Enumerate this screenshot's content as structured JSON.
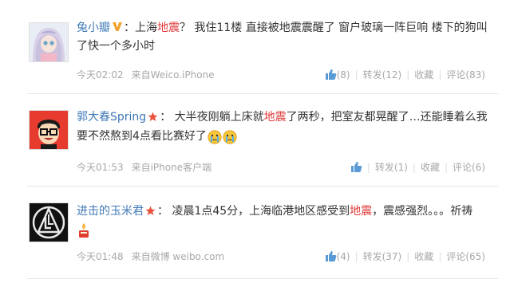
{
  "posts": [
    {
      "user": "兔小瓣",
      "badge": "v-badge",
      "text_before": "：上海",
      "keyword": "地震",
      "text_after": "？ 我住11楼 直接被地震震醒了 窗户玻璃一阵巨响 楼下的狗叫了快一个多小时",
      "time": "今天02:02",
      "source": "来自Weico.iPhone",
      "like_count": "(8)",
      "repost": "转发(12)",
      "favorite": "收藏",
      "comment": "评论(83)"
    },
    {
      "user": "郭大春Spring",
      "badge": "star-badge",
      "text_before": "： 大半夜刚躺上床就",
      "keyword": "地震",
      "text_after": "了两秒，把室友都晃醒了…还能睡着么我要不然熬到4点看比赛好了",
      "time": "今天01:53",
      "source": "来自iPhone客户端",
      "like_count": "",
      "repost": "转发(1)",
      "favorite": "收藏",
      "comment": "评论(6)"
    },
    {
      "user": "进击的玉米君",
      "badge": "star-badge",
      "text_before": "： 凌晨1点45分，上海临港地区感受到",
      "keyword": "地震",
      "text_after": "，震感强烈。。。祈祷",
      "time": "今天01:48",
      "source": "来自微博 weibo.com",
      "like_count": "(4)",
      "repost": "转发(37)",
      "favorite": "收藏",
      "comment": "评论(65)"
    }
  ],
  "colors": {
    "link": "#3f79b6",
    "keyword": "#e03a3a",
    "meta": "#a8a8a8"
  }
}
